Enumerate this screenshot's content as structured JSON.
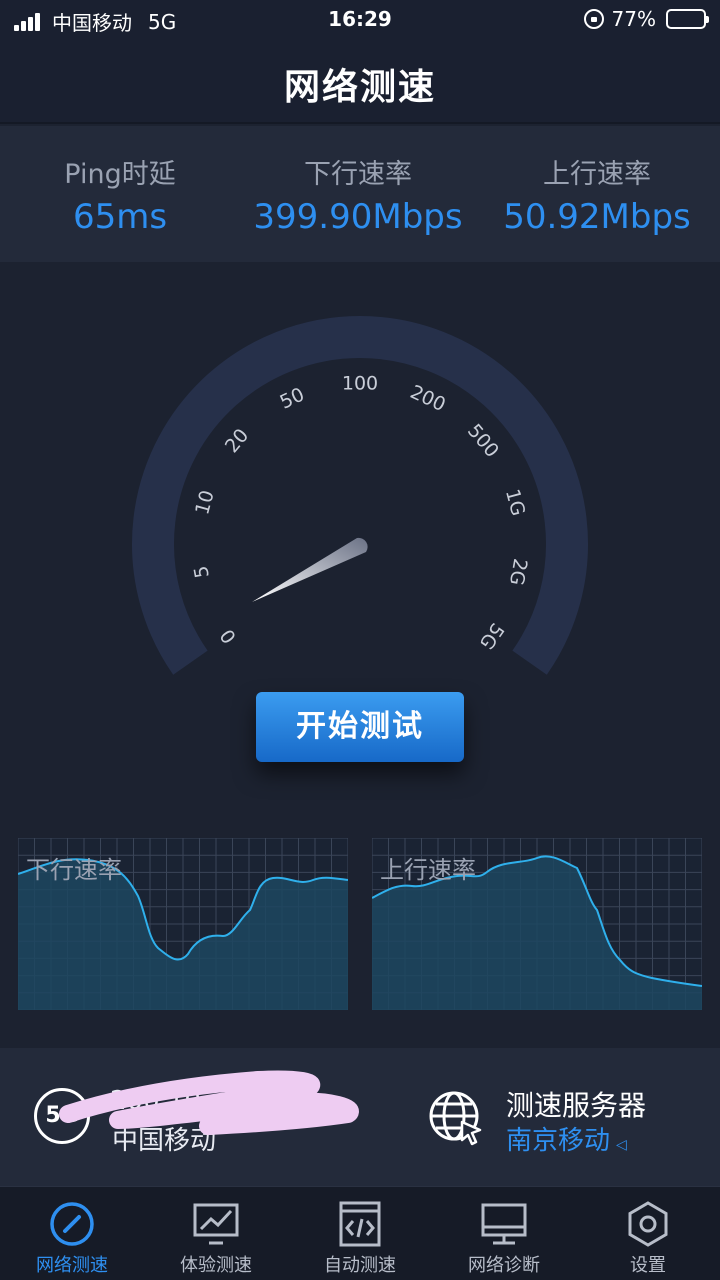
{
  "status_bar": {
    "carrier": "中国移动",
    "network": "5G",
    "time": "16:29",
    "battery": "77%",
    "battery_level": 0.77
  },
  "header": {
    "title": "网络测速"
  },
  "stats": {
    "ping": {
      "label": "Ping时延",
      "value": "65ms"
    },
    "download": {
      "label": "下行速率",
      "value": "399.90Mbps"
    },
    "upload": {
      "label": "上行速率",
      "value": "50.92Mbps"
    }
  },
  "gauge": {
    "ticks": [
      "0",
      "5",
      "10",
      "20",
      "50",
      "100",
      "200",
      "500",
      "1G",
      "2G",
      "5G"
    ],
    "needle_value": "0"
  },
  "start_button": {
    "label": "开始测试"
  },
  "charts": {
    "download": {
      "label": "下行速率"
    },
    "upload": {
      "label": "上行速率"
    }
  },
  "sim_info": {
    "badge": "5G",
    "line1": "200 10",
    "line2": "中国移动"
  },
  "server": {
    "title": "测速服务器",
    "name": "南京移动",
    "caret": "◁"
  },
  "tabs": [
    {
      "label": "网络测速",
      "icon": "speedometer-icon",
      "active": true
    },
    {
      "label": "体验测速",
      "icon": "chart-monitor-icon",
      "active": false
    },
    {
      "label": "自动测速",
      "icon": "code-window-icon",
      "active": false
    },
    {
      "label": "网络诊断",
      "icon": "monitor-icon",
      "active": false
    },
    {
      "label": "设置",
      "icon": "gear-hexagon-icon",
      "active": false
    }
  ],
  "colors": {
    "accent": "#2e8ff0",
    "background": "#1c2230",
    "panel": "#232a3a",
    "gauge_track": "#26304a"
  }
}
